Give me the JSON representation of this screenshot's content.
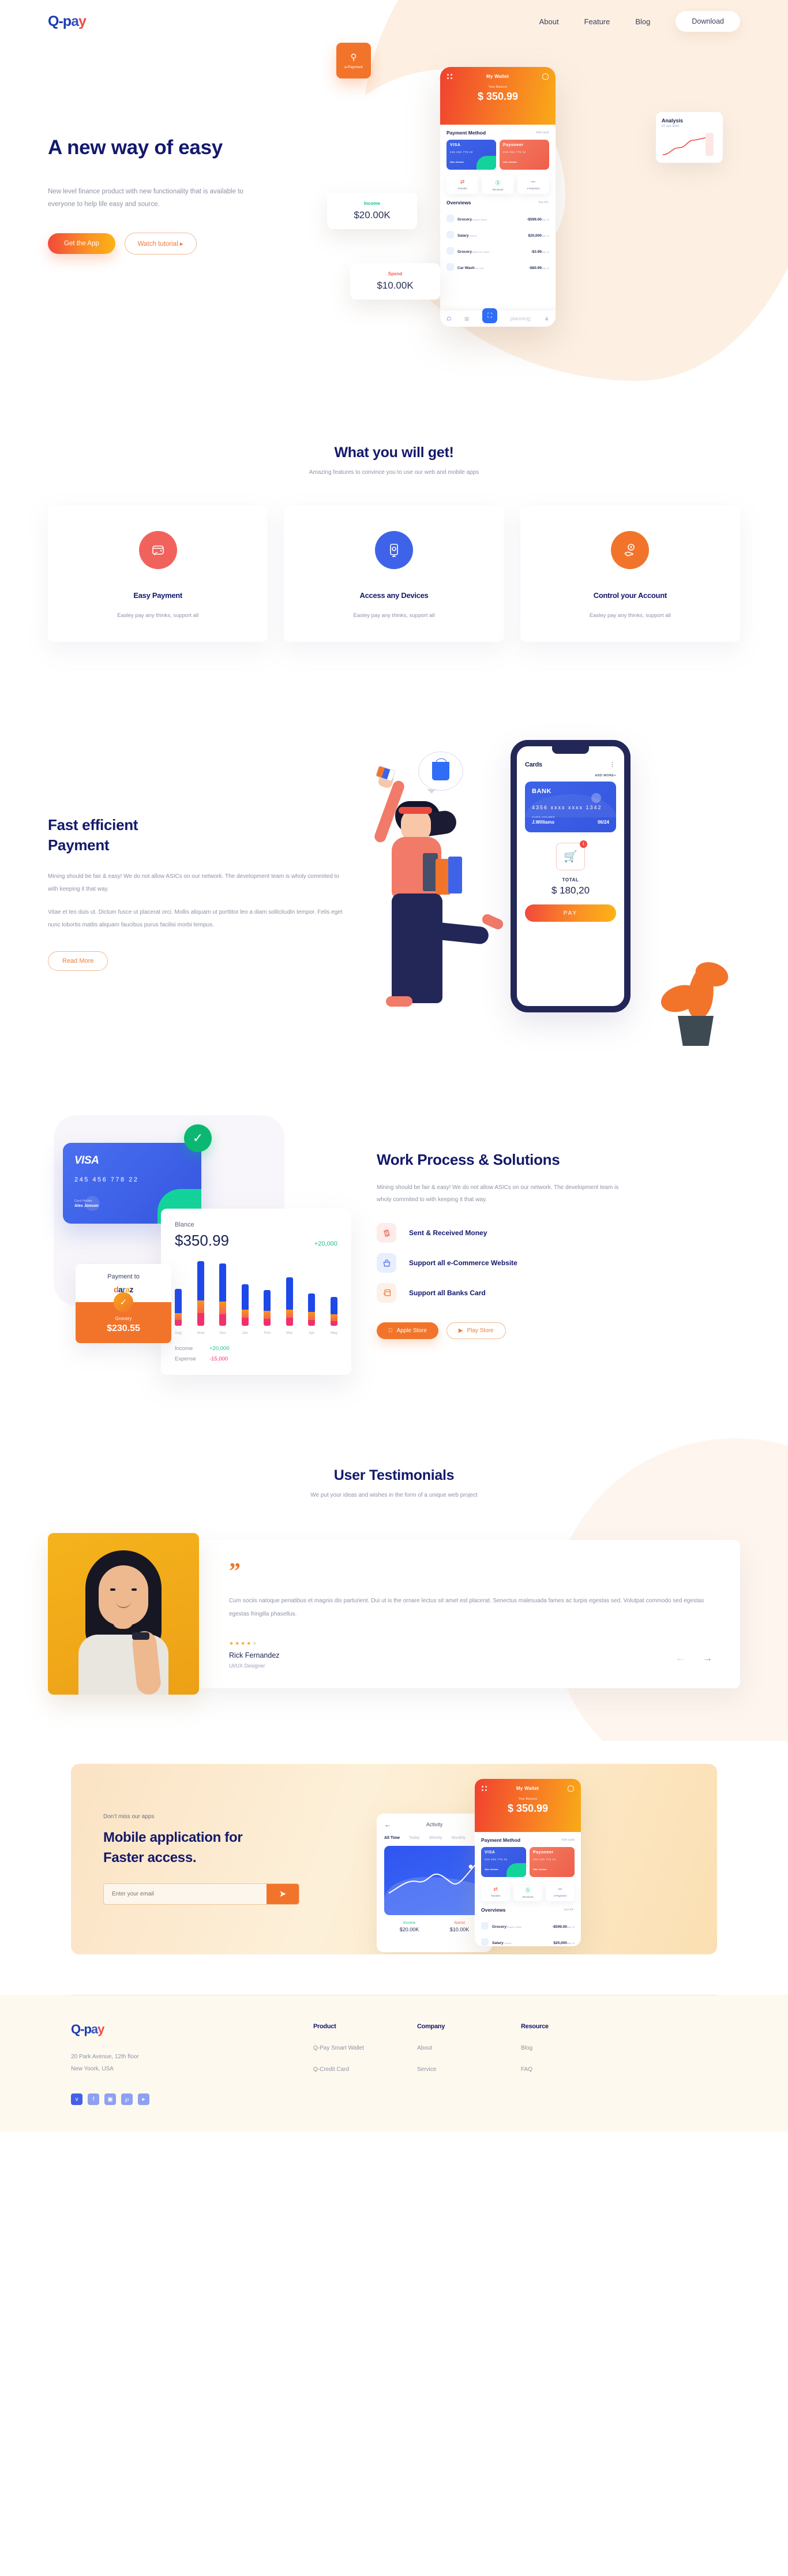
{
  "brand": {
    "logo_text": "Q-pay",
    "q": "Q",
    "dash": "-",
    "p": "p",
    "a": "a",
    "y": "y"
  },
  "nav": {
    "links": [
      {
        "label": "About"
      },
      {
        "label": "Feature"
      },
      {
        "label": "Blog"
      }
    ],
    "download_label": "Download"
  },
  "hero": {
    "title": "A new way of easy",
    "subtitle": "New level finance product with new functionality that is available to everyone to help life easy and source.",
    "primary_cta": "Get the App",
    "secondary_cta": "Watch tutorial ▸",
    "phone": {
      "title": "My  Wallet",
      "balance_label": "Your Balance",
      "balance": "$ 350.99",
      "payment_method_title": "Payment Method",
      "add_cards": "Add cards",
      "cards": [
        {
          "brand": "VISA",
          "number": "245  456  778  22",
          "holder_label": "Card Holder",
          "holder": "Alex Jonson",
          "exp_label": "Exp Date",
          "exp": "6/23"
        },
        {
          "brand": "Payoneer",
          "number": "245  456  778  22",
          "holder_label": "Card Holder",
          "holder": "Alex Jonson",
          "exp_label": "Exp Date",
          "exp": "6/23"
        }
      ],
      "actions": [
        {
          "icon": "transfer-icon",
          "label": "Transfer",
          "glyph": "⇄"
        },
        {
          "icon": "received-icon",
          "label": "Received",
          "glyph": "Ⓢ"
        },
        {
          "icon": "epayment-icon",
          "label": "e-Payment",
          "glyph": "⎓"
        }
      ],
      "overviews_title": "Overviews",
      "see_all": "See All ›",
      "overviews": [
        {
          "title": "Grocery",
          "sub": "Shopee Online",
          "amount": "-$599.00",
          "date": "May 25"
        },
        {
          "title": "Salary",
          "sub": "Finance",
          "amount": "$20,000",
          "date": "May 25"
        },
        {
          "title": "Grocery",
          "sub": "Starbucks Coffee",
          "amount": "-$3.99",
          "date": "May 24"
        },
        {
          "title": "Car Wash",
          "sub": "Car Care",
          "amount": "-$80.99",
          "date": "May 20"
        }
      ]
    },
    "analysis_card": {
      "title": "Analysis",
      "date": "07 Jun 2020"
    },
    "income_card": {
      "label": "Income",
      "value": "$20.00K"
    },
    "spend_card": {
      "label": "Spend",
      "value": "$10.00K"
    },
    "epay_card": {
      "label": "e-Payment"
    }
  },
  "features": {
    "title": "What you will get!",
    "subtitle": "Amazing features to convince you to use our  web and mobile apps",
    "cards": [
      {
        "icon": "wallet-contactless-icon",
        "glyph": "◭",
        "color": "#f2625c",
        "title": "Easy Payment",
        "desc": "Easley pay any thinks, support all"
      },
      {
        "icon": "device-mobile-icon",
        "glyph": "▣",
        "color": "#3f63e8",
        "title": "Access any Devices",
        "desc": "Easley pay any thinks, support all"
      },
      {
        "icon": "money-hand-icon",
        "glyph": "◔",
        "color": "#f2742b",
        "title": "Control your Account",
        "desc": "Easley pay any thinks, support all"
      }
    ]
  },
  "fastpay": {
    "title_line1": "Fast efficient",
    "title_line2": "Payment",
    "para1": "Mining should be fair & easy! We do not allow ASICs on our network. The development team is wholy commited to with keeping it that way.",
    "para2": "Vitae et leo duis ut. Dictum fusce ut placerat orci. Mollis aliquam ut porttitor leo a diam sollicitudin tempor. Felis eget nunc lobortis mattis aliquam faucibus purus facilisi morbi tempus.",
    "cta": "Read More",
    "phone": {
      "title": "Cards",
      "add_more": "ADD MORE+",
      "card_brand": "BANK",
      "card_number": "4356   xxxx   xxxx   1342",
      "holder_label": "CARS HOLDER",
      "holder": "J.Williams",
      "exp": "06/24",
      "cart_badge": "1",
      "total_label": "TOTAL",
      "total": "$ 180,20",
      "pay_label": "PAY"
    }
  },
  "work": {
    "title": "Work Process & Solutions",
    "desc": "Mining should be fair & easy! We do not allow ASICs on our network. The development team is wholy commited to with keeping it that way.",
    "features": [
      {
        "icon": "money-exchange-icon",
        "glyph": "↻",
        "bg": "#fdecea",
        "fg": "#ef5f55",
        "label": "Sent & Received Money"
      },
      {
        "icon": "shopping-basket-icon",
        "glyph": "⌥",
        "bg": "#e9eeff",
        "fg": "#3f63e8",
        "label": "Support all e-Commerce Website"
      },
      {
        "icon": "bank-card-icon",
        "glyph": "▤",
        "bg": "#fdf0e6",
        "fg": "#f2742b",
        "label": "Support all Banks Card"
      }
    ],
    "apple_store": "Apple Store",
    "play_store": "Play Store",
    "visa": {
      "brand": "VISA",
      "number": "245  456  778  22",
      "holder_label": "Card Holder",
      "holder": "Alex Jonson"
    },
    "payment_to": {
      "heading": "Payment to",
      "merchant": "daraz",
      "category": "Grocery",
      "amount": "$230.55"
    },
    "balance": {
      "label": "Blance",
      "amount": "$350.99",
      "delta": "+20,000",
      "income_label": "Income",
      "income_value": "+20,000",
      "expense_label": "Expense",
      "expense_value": "-15,000"
    }
  },
  "chart_data": {
    "type": "bar",
    "title": "Blance",
    "xlabel": "",
    "ylabel": "",
    "grid": false,
    "legend_position": "below",
    "categories": [
      "Aug",
      "Now",
      "Dec",
      "Jan",
      "Feb",
      "Mar",
      "Apr",
      "May"
    ],
    "series": [
      {
        "name": "Blue",
        "color": "#1f48e8",
        "values": [
          42,
          68,
          66,
          44,
          36,
          56,
          32,
          30
        ]
      },
      {
        "name": "Orange",
        "color": "#f7941e",
        "values": [
          12,
          22,
          22,
          14,
          14,
          14,
          14,
          12
        ]
      },
      {
        "name": "Pink",
        "color": "#f2306b",
        "values": [
          10,
          22,
          20,
          14,
          12,
          14,
          10,
          8
        ]
      }
    ],
    "annotations": [
      "Income +20,000",
      "Expense -15,000"
    ]
  },
  "testimonials": {
    "title": "User Testimonials",
    "subtitle": "We put your ideas and wishes in the form of a unique web project",
    "quote_mark": "”",
    "text": "Cum sociis natoque penatibus et magnis dis parturient. Dui ut is the ornare lectus sit amet est placerat. Senectus malesuada fames ac turpis egestas sed. Volutpat commodo sed egestas egestas fringilla phasellus.",
    "stars_filled": "★★★★",
    "stars_empty": "★",
    "name": "Rick Fernandez",
    "role": "UI/UX Designer",
    "prev": "←",
    "next": "→"
  },
  "cta": {
    "eyebrow": "Don’t miss our apps",
    "title_line1": "Mobile application for",
    "title_line2": "Faster access.",
    "email_placeholder": "Enter your email",
    "email_value": "",
    "submit_glyph": "➤",
    "activity": {
      "title": "Activity",
      "tabs": [
        "All Time",
        "Today",
        "Weekly",
        "Monthly"
      ],
      "income_label": "Income",
      "income_value": "$20.00K",
      "spend_label": "Spend",
      "spend_value": "$10.00K"
    },
    "phone": {
      "title": "My  Wallet",
      "balance_label": "Your Balance",
      "balance": "$ 350.99",
      "payment_method_title": "Payment Method",
      "add_cards": "Add cards",
      "overviews_title": "Overviews",
      "see_all": "See All ›"
    }
  },
  "footer": {
    "address_line1": "20 Park Avenue, 12th floor",
    "address_line2": "New Yoork, USA",
    "socials": [
      {
        "name": "twitter-icon",
        "glyph": "ᴠ"
      },
      {
        "name": "facebook-icon",
        "glyph": "f"
      },
      {
        "name": "instagram-icon",
        "glyph": "▣"
      },
      {
        "name": "pinterest-icon",
        "glyph": "℘"
      },
      {
        "name": "youtube-icon",
        "glyph": "▸"
      }
    ],
    "columns": [
      {
        "heading": "Product",
        "links": [
          {
            "label": "Q-Pay Smart Wallet"
          },
          {
            "label": "Q-Credit Card"
          }
        ]
      },
      {
        "heading": "Company",
        "links": [
          {
            "label": "About"
          },
          {
            "label": "Service"
          }
        ]
      },
      {
        "heading": "Resource",
        "links": [
          {
            "label": "Blog"
          },
          {
            "label": "FAQ"
          }
        ]
      }
    ]
  },
  "colors": {
    "navy": "#13196b",
    "orange": "#f2742b",
    "red": "#ef4b44",
    "blue": "#3f63e8",
    "green": "#14c38a",
    "pink": "#f2306b",
    "cream": "#fdf0e3"
  }
}
